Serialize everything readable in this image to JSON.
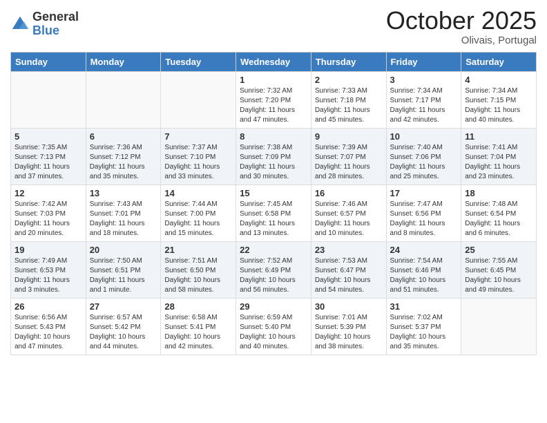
{
  "header": {
    "logo_general": "General",
    "logo_blue": "Blue",
    "month_title": "October 2025",
    "location": "Olivais, Portugal"
  },
  "days_of_week": [
    "Sunday",
    "Monday",
    "Tuesday",
    "Wednesday",
    "Thursday",
    "Friday",
    "Saturday"
  ],
  "weeks": [
    [
      {
        "day": "",
        "info": ""
      },
      {
        "day": "",
        "info": ""
      },
      {
        "day": "",
        "info": ""
      },
      {
        "day": "1",
        "info": "Sunrise: 7:32 AM\nSunset: 7:20 PM\nDaylight: 11 hours and 47 minutes."
      },
      {
        "day": "2",
        "info": "Sunrise: 7:33 AM\nSunset: 7:18 PM\nDaylight: 11 hours and 45 minutes."
      },
      {
        "day": "3",
        "info": "Sunrise: 7:34 AM\nSunset: 7:17 PM\nDaylight: 11 hours and 42 minutes."
      },
      {
        "day": "4",
        "info": "Sunrise: 7:34 AM\nSunset: 7:15 PM\nDaylight: 11 hours and 40 minutes."
      }
    ],
    [
      {
        "day": "5",
        "info": "Sunrise: 7:35 AM\nSunset: 7:13 PM\nDaylight: 11 hours and 37 minutes."
      },
      {
        "day": "6",
        "info": "Sunrise: 7:36 AM\nSunset: 7:12 PM\nDaylight: 11 hours and 35 minutes."
      },
      {
        "day": "7",
        "info": "Sunrise: 7:37 AM\nSunset: 7:10 PM\nDaylight: 11 hours and 33 minutes."
      },
      {
        "day": "8",
        "info": "Sunrise: 7:38 AM\nSunset: 7:09 PM\nDaylight: 11 hours and 30 minutes."
      },
      {
        "day": "9",
        "info": "Sunrise: 7:39 AM\nSunset: 7:07 PM\nDaylight: 11 hours and 28 minutes."
      },
      {
        "day": "10",
        "info": "Sunrise: 7:40 AM\nSunset: 7:06 PM\nDaylight: 11 hours and 25 minutes."
      },
      {
        "day": "11",
        "info": "Sunrise: 7:41 AM\nSunset: 7:04 PM\nDaylight: 11 hours and 23 minutes."
      }
    ],
    [
      {
        "day": "12",
        "info": "Sunrise: 7:42 AM\nSunset: 7:03 PM\nDaylight: 11 hours and 20 minutes."
      },
      {
        "day": "13",
        "info": "Sunrise: 7:43 AM\nSunset: 7:01 PM\nDaylight: 11 hours and 18 minutes."
      },
      {
        "day": "14",
        "info": "Sunrise: 7:44 AM\nSunset: 7:00 PM\nDaylight: 11 hours and 15 minutes."
      },
      {
        "day": "15",
        "info": "Sunrise: 7:45 AM\nSunset: 6:58 PM\nDaylight: 11 hours and 13 minutes."
      },
      {
        "day": "16",
        "info": "Sunrise: 7:46 AM\nSunset: 6:57 PM\nDaylight: 11 hours and 10 minutes."
      },
      {
        "day": "17",
        "info": "Sunrise: 7:47 AM\nSunset: 6:56 PM\nDaylight: 11 hours and 8 minutes."
      },
      {
        "day": "18",
        "info": "Sunrise: 7:48 AM\nSunset: 6:54 PM\nDaylight: 11 hours and 6 minutes."
      }
    ],
    [
      {
        "day": "19",
        "info": "Sunrise: 7:49 AM\nSunset: 6:53 PM\nDaylight: 11 hours and 3 minutes."
      },
      {
        "day": "20",
        "info": "Sunrise: 7:50 AM\nSunset: 6:51 PM\nDaylight: 11 hours and 1 minute."
      },
      {
        "day": "21",
        "info": "Sunrise: 7:51 AM\nSunset: 6:50 PM\nDaylight: 10 hours and 58 minutes."
      },
      {
        "day": "22",
        "info": "Sunrise: 7:52 AM\nSunset: 6:49 PM\nDaylight: 10 hours and 56 minutes."
      },
      {
        "day": "23",
        "info": "Sunrise: 7:53 AM\nSunset: 6:47 PM\nDaylight: 10 hours and 54 minutes."
      },
      {
        "day": "24",
        "info": "Sunrise: 7:54 AM\nSunset: 6:46 PM\nDaylight: 10 hours and 51 minutes."
      },
      {
        "day": "25",
        "info": "Sunrise: 7:55 AM\nSunset: 6:45 PM\nDaylight: 10 hours and 49 minutes."
      }
    ],
    [
      {
        "day": "26",
        "info": "Sunrise: 6:56 AM\nSunset: 5:43 PM\nDaylight: 10 hours and 47 minutes."
      },
      {
        "day": "27",
        "info": "Sunrise: 6:57 AM\nSunset: 5:42 PM\nDaylight: 10 hours and 44 minutes."
      },
      {
        "day": "28",
        "info": "Sunrise: 6:58 AM\nSunset: 5:41 PM\nDaylight: 10 hours and 42 minutes."
      },
      {
        "day": "29",
        "info": "Sunrise: 6:59 AM\nSunset: 5:40 PM\nDaylight: 10 hours and 40 minutes."
      },
      {
        "day": "30",
        "info": "Sunrise: 7:01 AM\nSunset: 5:39 PM\nDaylight: 10 hours and 38 minutes."
      },
      {
        "day": "31",
        "info": "Sunrise: 7:02 AM\nSunset: 5:37 PM\nDaylight: 10 hours and 35 minutes."
      },
      {
        "day": "",
        "info": ""
      }
    ]
  ]
}
